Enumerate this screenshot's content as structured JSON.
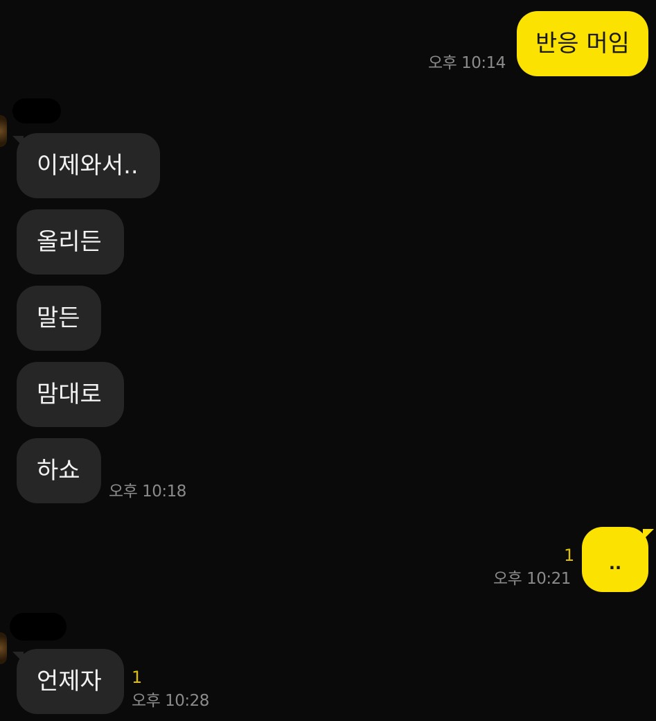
{
  "conversation": [
    {
      "direction": "out",
      "text": "반응 머임",
      "time": "오후 10:14"
    },
    {
      "direction": "in",
      "text": "이제와서..",
      "time": ""
    },
    {
      "direction": "in",
      "text": "올리든",
      "time": ""
    },
    {
      "direction": "in",
      "text": "말든",
      "time": ""
    },
    {
      "direction": "in",
      "text": "맘대로",
      "time": ""
    },
    {
      "direction": "in",
      "text": "하쇼",
      "time": "오후 10:18"
    },
    {
      "direction": "out",
      "text": "..",
      "time": "오후 10:21",
      "unread": "1"
    },
    {
      "direction": "in",
      "text": "언제자",
      "time": "오후 10:28",
      "unread": "1"
    }
  ],
  "colors": {
    "background": "#0a0a0a",
    "outgoing_bubble": "#fbe200",
    "incoming_bubble": "#262626",
    "unread_count": "#e0c100",
    "timestamp": "#8b8b8b"
  }
}
